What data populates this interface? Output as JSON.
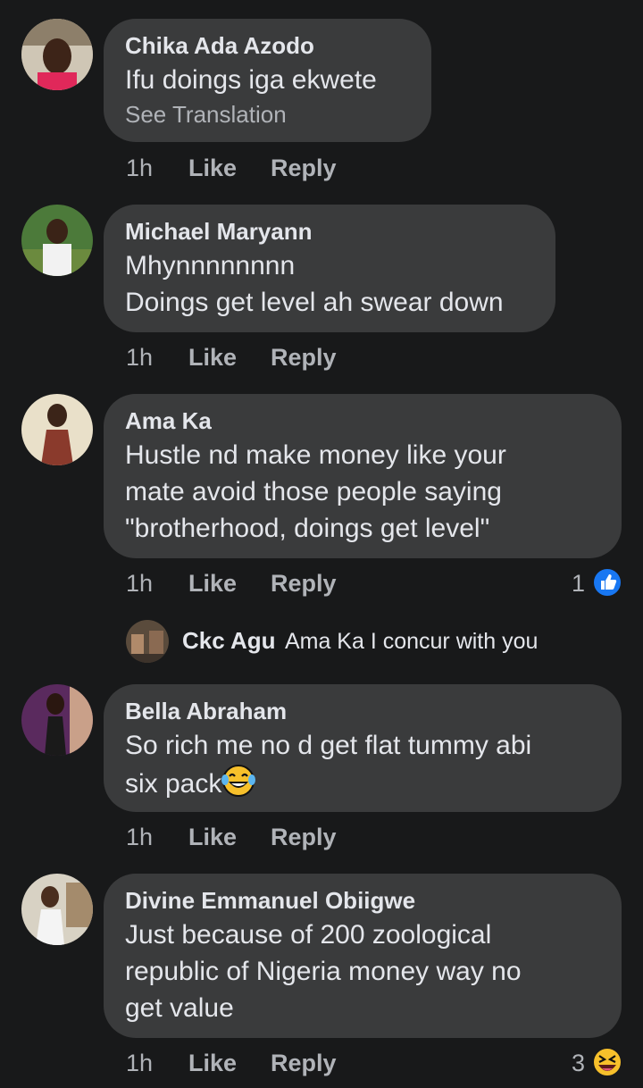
{
  "actions": {
    "time": "1h",
    "like": "Like",
    "reply": "Reply"
  },
  "comments": [
    {
      "name": "Chika Ada Azodo",
      "lines": [
        "Ifu doings iga  ekwete"
      ],
      "see_translation": "See Translation"
    },
    {
      "name": "Michael Maryann",
      "lines": [
        "Mhynnnnnnnn",
        "Doings get level ah swear down"
      ]
    },
    {
      "name": "Ama Ka",
      "lines": [
        "Hustle nd make money like your",
        "mate avoid those people saying",
        "\"brotherhood, doings get level\""
      ],
      "reaction_count": "1",
      "reaction_icon": "like-reaction-icon"
    },
    {
      "name": "Bella Abraham",
      "lines": [
        "So rich me no d get flat tummy abi",
        "six pack"
      ],
      "emoji": "tears-of-joy-emoji"
    },
    {
      "name": "Divine Emmanuel Obiigwe",
      "lines": [
        "Just  because  of  200 zoological",
        "republic of Nigeria  money  way no",
        "get value"
      ],
      "reaction_count": "3",
      "reaction_icon": "laughing-reaction-icon"
    }
  ],
  "reply": {
    "name": "Ckc Agu",
    "text": "Ama Ka I concur with you"
  },
  "colors": {
    "background": "#18191a",
    "bubble": "#3a3b3c",
    "text": "#e4e6eb",
    "secondary": "#b0b3b8",
    "like_blue": "#1877f2",
    "emoji_yellow": "#f7c02b"
  }
}
